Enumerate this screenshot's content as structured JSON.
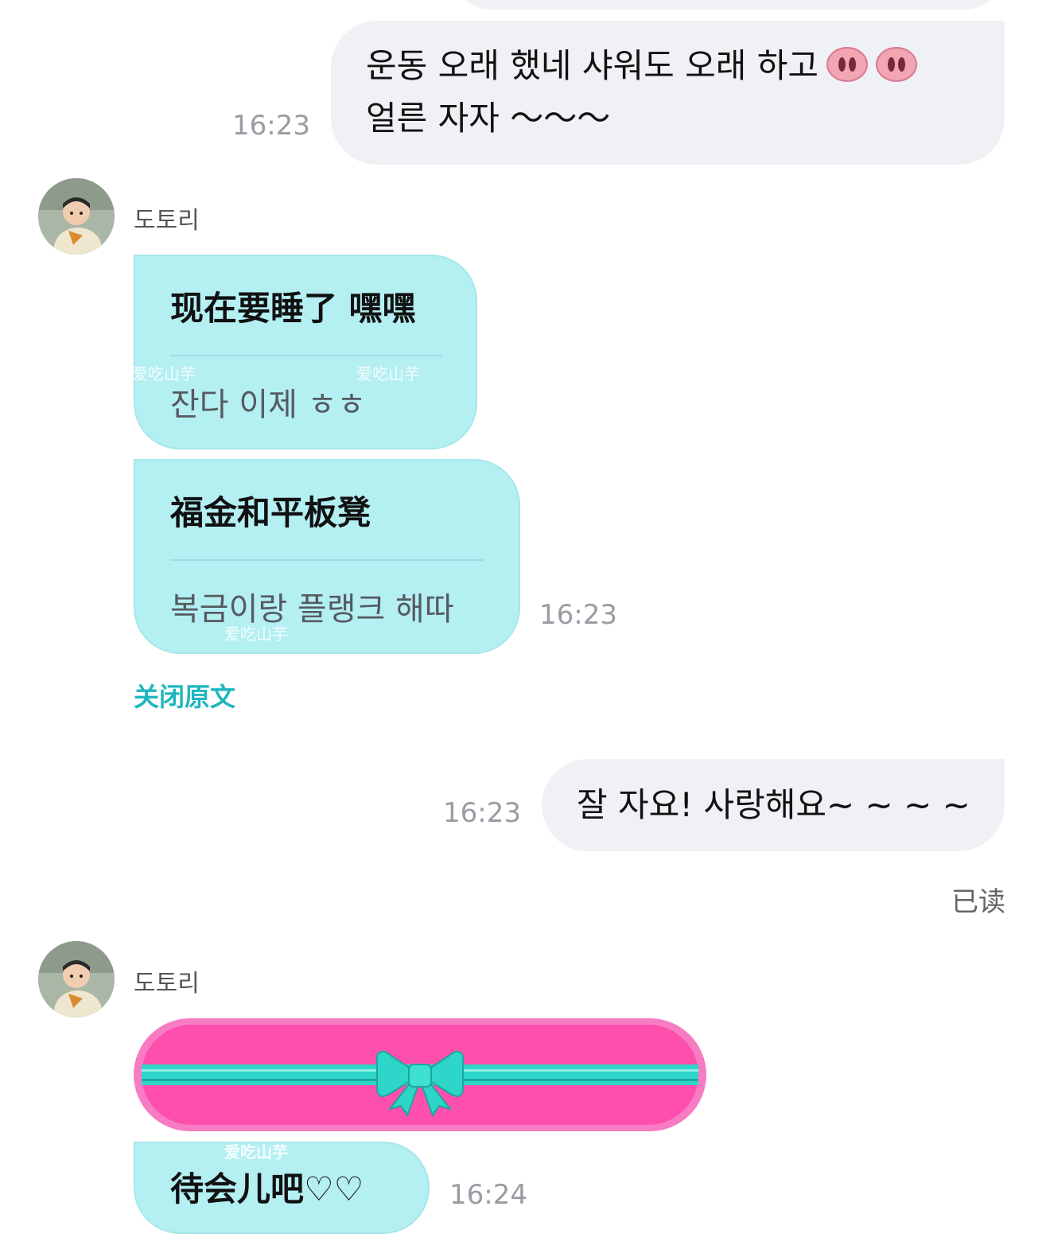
{
  "conversation": {
    "messages": [
      {
        "direction": "outgoing",
        "line1": "운동 오래 했네 샤워도 오래 하고",
        "emoji": [
          "pig-nose-emoji",
          "pig-nose-emoji"
        ],
        "line2": "얼른 자자 ～～～",
        "time": "16:23"
      },
      {
        "direction": "incoming",
        "sender": "도토리",
        "original": "现在要睡了 嘿嘿",
        "translation": "잔다 이제 ㅎㅎ"
      },
      {
        "direction": "incoming",
        "sender": "도토리",
        "original": "福金和平板凳",
        "translation": "복금이랑 플랭크 해따",
        "time": "16:23",
        "close_original_label": "关闭原文"
      },
      {
        "direction": "outgoing",
        "text": "잘 자요! 사랑해요~ ~ ~ ~",
        "time": "16:23",
        "status": "已读"
      },
      {
        "direction": "incoming",
        "sender": "도토리",
        "type": "gift-ribbon"
      },
      {
        "direction": "incoming",
        "sender": "도토리",
        "text": "待会儿吧♡♡",
        "time": "16:24"
      }
    ]
  },
  "watermark": "爱吃山芋",
  "colors": {
    "outgoing_bubble": "#f0f1f5",
    "incoming_bubble": "#b4eff2",
    "accent_link": "#1fb6c0",
    "gift_pink": "#ff4fad",
    "gift_ribbon": "#2ed6c9"
  }
}
